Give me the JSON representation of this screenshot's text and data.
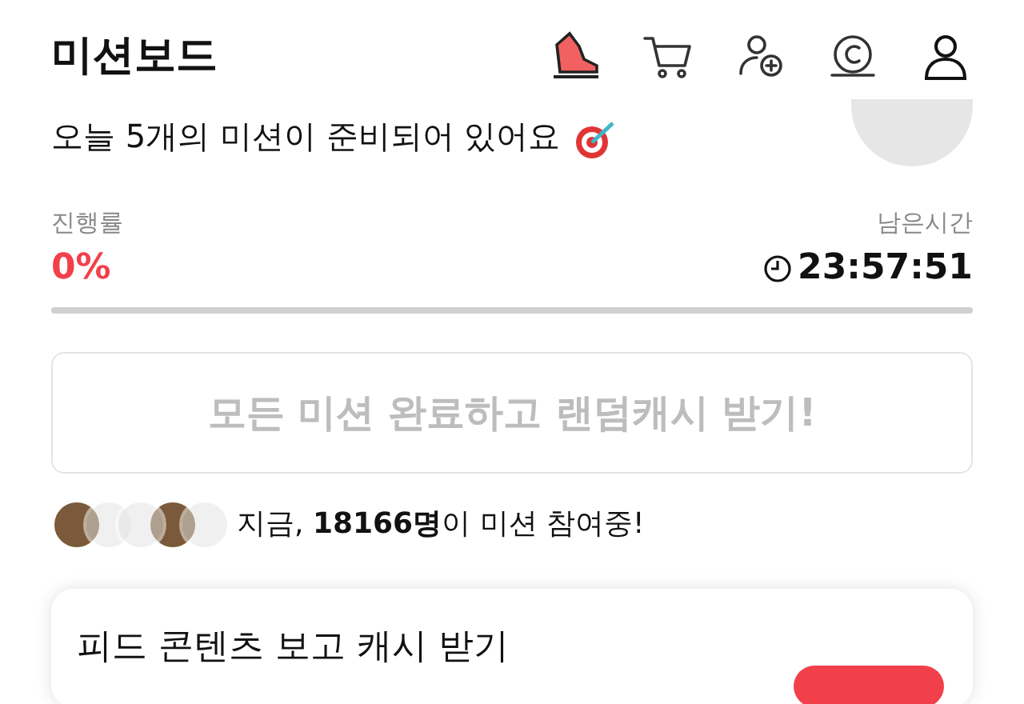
{
  "header": {
    "title": "미션보드"
  },
  "greeting": "오늘 5개의 미션이 준비되어 있어요",
  "progress": {
    "label": "진행률",
    "value": "0%",
    "level": 0
  },
  "timer": {
    "label": "남은시간",
    "value": "23:57:51"
  },
  "complete_button": {
    "label": "모든 미션 완료하고 랜덤캐시 받기!",
    "disabled": true
  },
  "participants": {
    "avatars": [
      {
        "kind": "photo"
      },
      {
        "kind": "placeholder"
      },
      {
        "kind": "placeholder"
      },
      {
        "kind": "photo"
      },
      {
        "kind": "placeholder"
      }
    ],
    "text": "지금, **18166명**이 미션 참여중!"
  },
  "mission_card": {
    "title": "피드 콘텐츠 보고 캐시 받기"
  }
}
